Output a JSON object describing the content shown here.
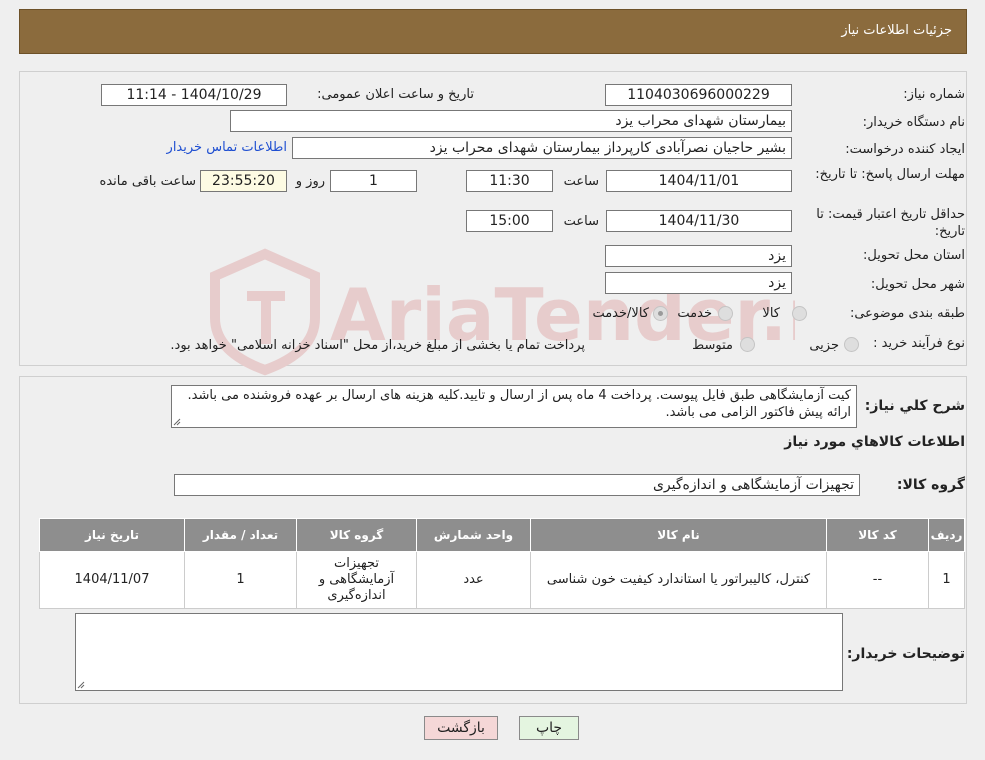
{
  "header": {
    "title": "جزئیات اطلاعات نیاز"
  },
  "form": {
    "need_number": {
      "label": "شماره نیاز:",
      "value": "1104030696000229"
    },
    "announce_datetime": {
      "label": "تاریخ و ساعت اعلان عمومی:",
      "value": "1404/10/29 - 11:14"
    },
    "buyer_org": {
      "label": "نام دستگاه خریدار:",
      "value": "بیمارستان شهدای محراب یزد"
    },
    "requester": {
      "label": "ایجاد کننده درخواست:",
      "value": "بشیر حاجیان نصرآبادی کارپرداز بیمارستان شهدای محراب یزد"
    },
    "contact_link": "اطلاعات تماس خریدار",
    "reply_deadline": {
      "label": "مهلت ارسال پاسخ: تا تاریخ:",
      "date": "1404/11/01",
      "time_label": "ساعت",
      "time": "11:30",
      "days": "1",
      "days_label": "روز و",
      "remaining": "23:55:20",
      "remaining_label": "ساعت باقی مانده"
    },
    "price_validity": {
      "label": "حداقل تاریخ اعتبار قیمت: تا تاریخ:",
      "date": "1404/11/30",
      "time_label": "ساعت",
      "time": "15:00"
    },
    "province": {
      "label": "استان محل تحویل:",
      "value": "یزد"
    },
    "city": {
      "label": "شهر محل تحویل:",
      "value": "یزد"
    },
    "category": {
      "label": "طبقه بندی موضوعی:",
      "options": [
        "کالا",
        "خدمت",
        "کالا/خدمت"
      ],
      "selected": "کالا/خدمت"
    },
    "purchase_type": {
      "label": "نوع فرآیند خرید :",
      "options": [
        "جزیی",
        "متوسط"
      ],
      "note": "پرداخت تمام یا بخشی از مبلغ خرید،از محل \"اسناد خزانه اسلامی\" خواهد بود."
    }
  },
  "details": {
    "summary_label": "شرح کلي نياز:",
    "summary_text": "کیت آزمایشگاهی طبق فایل پیوست. پرداخت 4 ماه پس از ارسال و تایید.کلیه هزینه های ارسال بر عهده فروشنده می باشد. ارائه پیش فاکتور الزامی می باشد.",
    "goods_info_title": "اطلاعات کالاهاي مورد نياز",
    "goods_group_label": "گروه کالا:",
    "goods_group_value": "تجهیزات آزمایشگاهی و اندازه‌گیری",
    "table": {
      "headers": [
        "رديف",
        "کد کالا",
        "نام کالا",
        "واحد شمارش",
        "گروه کالا",
        "تعداد / مقدار",
        "تاريخ نياز"
      ],
      "rows": [
        [
          "1",
          "--",
          "کنترل، کالیبراتور یا استاندارد کیفیت خون شناسی",
          "عدد",
          "تجهیزات آزمایشگاهی و اندازه‌گیری",
          "1",
          "1404/11/07"
        ]
      ]
    },
    "buyer_notes_label": "توضیحات خریدار:",
    "buyer_notes_value": ""
  },
  "buttons": {
    "print": "چاپ",
    "back": "بازگشت"
  },
  "watermark": {
    "text": "AriaTender.neT",
    "color": "#e7cccc"
  },
  "colors": {
    "header_bg": "#8b6b3d",
    "table_header_bg": "#8e8e8e",
    "back_btn_bg": "#f5d7d7",
    "print_btn_bg": "#e4f5e0"
  }
}
